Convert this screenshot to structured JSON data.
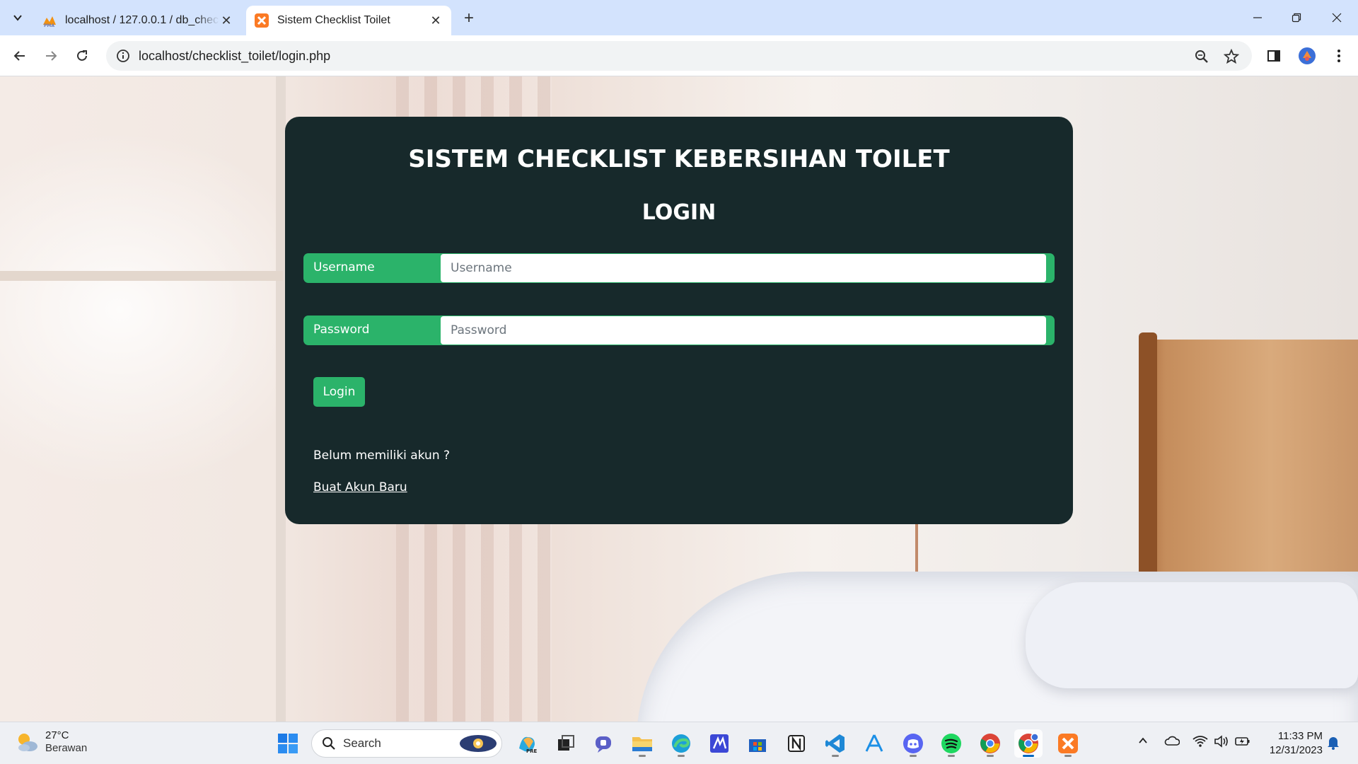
{
  "browser": {
    "tabs": [
      {
        "title": "localhost / 127.0.0.1 / db_checklist_toilet",
        "icon": "phpmyadmin-icon",
        "active": false
      },
      {
        "title": "Sistem Checklist Toilet",
        "icon": "xampp-icon",
        "active": true
      }
    ],
    "url": "localhost/checklist_toilet/login.php"
  },
  "login": {
    "app_title": "SISTEM CHECKLIST KEBERSIHAN TOILET",
    "form_title": "LOGIN",
    "username_label": "Username",
    "username_placeholder": "Username",
    "username_value": "",
    "password_label": "Password",
    "password_placeholder": "Password",
    "password_value": "",
    "login_button": "Login",
    "no_account_text": "Belum memiliki akun ?",
    "create_account_link": "Buat Akun Baru"
  },
  "taskbar": {
    "weather": {
      "temp": "27°C",
      "condition": "Berawan"
    },
    "search_label": "Search",
    "time": "11:33 PM",
    "date": "12/31/2023",
    "apps": [
      "start-icon",
      "copilot-icon",
      "task-view-icon",
      "teams-icon",
      "file-explorer-icon",
      "edge-icon",
      "vscode-blue-icon",
      "store-icon",
      "notion-icon",
      "vscode-icon",
      "app-store-icon",
      "discord-icon",
      "spotify-icon",
      "chrome-icon",
      "chrome-profile-icon",
      "xampp-icon"
    ]
  },
  "colors": {
    "card_bg": "#17292b",
    "accent_green": "#2bb36a",
    "tabstrip_bg": "#d3e3fd"
  }
}
